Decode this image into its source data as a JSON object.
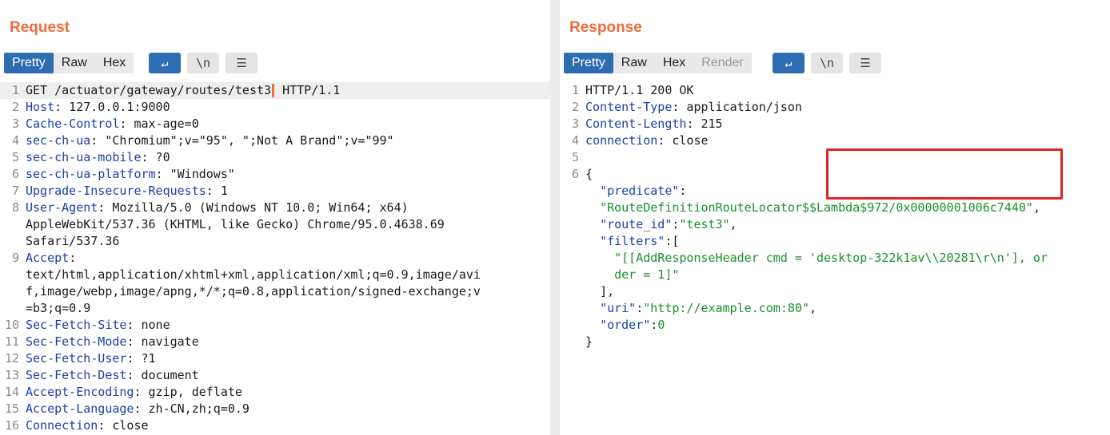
{
  "request": {
    "title": "Request",
    "tabs": [
      {
        "label": "Pretty",
        "active": true
      },
      {
        "label": "Raw",
        "active": false
      },
      {
        "label": "Hex",
        "active": false
      }
    ],
    "tools": [
      {
        "name": "wrap-icon",
        "glyph": "↵",
        "active": true
      },
      {
        "name": "newline-icon",
        "glyph": "\\n",
        "active": false
      },
      {
        "name": "menu-icon",
        "glyph": "☰",
        "active": false
      }
    ],
    "lines": [
      {
        "n": "1",
        "text": "GET /actuator/gateway/routes/test3",
        "tail": " HTTP/1.1"
      },
      {
        "n": "2",
        "key": "Host",
        "value": " 127.0.0.1:9000"
      },
      {
        "n": "3",
        "key": "Cache-Control",
        "value": " max-age=0"
      },
      {
        "n": "4",
        "key": "sec-ch-ua",
        "value": " \"Chromium\";v=\"95\", \";Not A Brand\";v=\"99\""
      },
      {
        "n": "5",
        "key": "sec-ch-ua-mobile",
        "value": " ?0"
      },
      {
        "n": "6",
        "key": "sec-ch-ua-platform",
        "value": " \"Windows\""
      },
      {
        "n": "7",
        "key": "Upgrade-Insecure-Requests",
        "value": " 1"
      },
      {
        "n": "8",
        "key": "User-Agent",
        "value": " Mozilla/5.0 (Windows NT 10.0; Win64; x64)"
      },
      {
        "n": "",
        "text": "AppleWebKit/537.36 (KHTML, like Gecko) Chrome/95.0.4638.69"
      },
      {
        "n": "",
        "text": "Safari/537.36"
      },
      {
        "n": "9",
        "key": "Accept",
        "value": ""
      },
      {
        "n": "",
        "text": "text/html,application/xhtml+xml,application/xml;q=0.9,image/avi"
      },
      {
        "n": "",
        "text": "f,image/webp,image/apng,*/*;q=0.8,application/signed-exchange;v"
      },
      {
        "n": "",
        "text": "=b3;q=0.9"
      },
      {
        "n": "10",
        "key": "Sec-Fetch-Site",
        "value": " none"
      },
      {
        "n": "11",
        "key": "Sec-Fetch-Mode",
        "value": " navigate"
      },
      {
        "n": "12",
        "key": "Sec-Fetch-User",
        "value": " ?1"
      },
      {
        "n": "13",
        "key": "Sec-Fetch-Dest",
        "value": " document"
      },
      {
        "n": "14",
        "key": "Accept-Encoding",
        "value": " gzip, deflate"
      },
      {
        "n": "15",
        "key": "Accept-Language",
        "value": " zh-CN,zh;q=0.9"
      },
      {
        "n": "16",
        "key": "Connection",
        "value": " close"
      }
    ]
  },
  "response": {
    "title": "Response",
    "tabs": [
      {
        "label": "Pretty",
        "active": true
      },
      {
        "label": "Raw",
        "active": false
      },
      {
        "label": "Hex",
        "active": false
      },
      {
        "label": "Render",
        "active": false,
        "disabled": true
      }
    ],
    "tools": [
      {
        "name": "wrap-icon",
        "glyph": "↵",
        "active": true
      },
      {
        "name": "newline-icon",
        "glyph": "\\n",
        "active": false
      },
      {
        "name": "menu-icon",
        "glyph": "☰",
        "active": false
      }
    ],
    "lines": [
      {
        "n": "1",
        "text": "HTTP/1.1 200 OK"
      },
      {
        "n": "2",
        "key": "Content-Type",
        "value": " application/json"
      },
      {
        "n": "3",
        "key": "Content-Length",
        "value": " 215"
      },
      {
        "n": "4",
        "key": "connection",
        "value": " close"
      },
      {
        "n": "5",
        "text": ""
      },
      {
        "n": "6",
        "text": "{"
      },
      {
        "n": "",
        "indent": "  ",
        "jkey": "\"predicate\"",
        "after": ":"
      },
      {
        "n": "",
        "indent": "  ",
        "jstr": "\"RouteDefinitionRouteLocator$$Lambda$972/0x00000001006c7440\"",
        "after": ","
      },
      {
        "n": "",
        "indent": "  ",
        "jkey": "\"route_id\"",
        "after": ":",
        "jstr2": "\"test3\"",
        "after2": ","
      },
      {
        "n": "",
        "indent": "  ",
        "jkey": "\"filters\"",
        "after": ":["
      },
      {
        "n": "",
        "indent": "    ",
        "jstr": "\"[[AddResponseHeader cmd = 'desktop-322k1av\\\\20281\\r\\n'], or"
      },
      {
        "n": "",
        "indent": "    ",
        "jstr": "der = 1]\""
      },
      {
        "n": "",
        "indent": "  ",
        "text": "],"
      },
      {
        "n": "",
        "indent": "  ",
        "jkey": "\"uri\"",
        "after": ":",
        "jstr2": "\"http://example.com:80\"",
        "after2": ","
      },
      {
        "n": "",
        "indent": "  ",
        "jkey": "\"order\"",
        "after": ":",
        "jnum": "0"
      },
      {
        "n": "",
        "text": "}"
      }
    ]
  },
  "layout_toggle": [
    {
      "name": "split-horizontal-icon",
      "active": true
    },
    {
      "name": "split-vertical-icon",
      "active": false
    },
    {
      "name": "single-pane-icon",
      "active": false
    }
  ],
  "colors": {
    "accent": "#2f6db3",
    "title": "#f06b3b",
    "header_key": "#1a3fa8",
    "json_string": "#18922a",
    "highlight": "#e02222"
  }
}
